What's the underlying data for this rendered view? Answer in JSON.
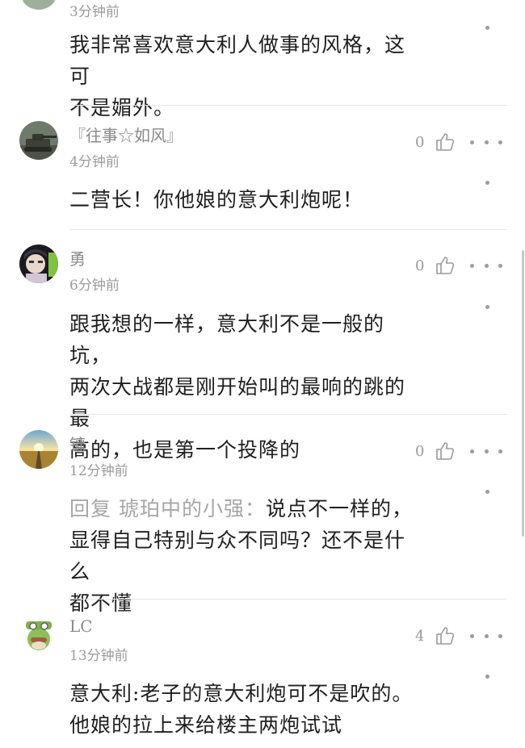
{
  "comments": [
    {
      "id": "c0",
      "timestamp": "3分钟前",
      "text_lines": [
        "我非常喜欢意大利人做事的风格，这可",
        "不是媚外。"
      ]
    },
    {
      "id": "c1",
      "username": "『往事☆如风』",
      "timestamp": "4分钟前",
      "likes": "0",
      "text_lines": [
        "二营长！你他娘的意大利炮呢！"
      ],
      "avatar_icon": "tank-avatar-icon"
    },
    {
      "id": "c2",
      "username": "勇",
      "timestamp": "6分钟前",
      "likes": "0",
      "text_lines": [
        "跟我想的一样，意大利不是一般的坑，",
        "两次大战都是刚开始叫的最响的跳的最",
        "高的，也是第一个投降的"
      ],
      "avatar_icon": "person-avatar-icon"
    },
    {
      "id": "c3",
      "username": "镛",
      "timestamp": "12分钟前",
      "likes": "0",
      "reply_prefix": "回复 琥珀中的小强：",
      "text_lines": [
        "说点不一样的，",
        "显得自己特别与众不同吗？还不是什么",
        "都不懂"
      ],
      "avatar_icon": "sunset-road-avatar-icon"
    },
    {
      "id": "c4",
      "username": "LC",
      "timestamp": "13分钟前",
      "likes": "4",
      "text_lines": [
        "意大利:老子的意大利炮可不是吹的。",
        "他娘的拉上来给楼主两炮试试"
      ],
      "avatar_icon": "cartoon-character-avatar-icon"
    }
  ],
  "icons": {
    "like": "thumbs-up-icon",
    "more": "more-dots-icon"
  },
  "colors": {
    "text": "#1f1f1f",
    "meta": "#9b9b9b",
    "divider": "#e6e6e6"
  }
}
